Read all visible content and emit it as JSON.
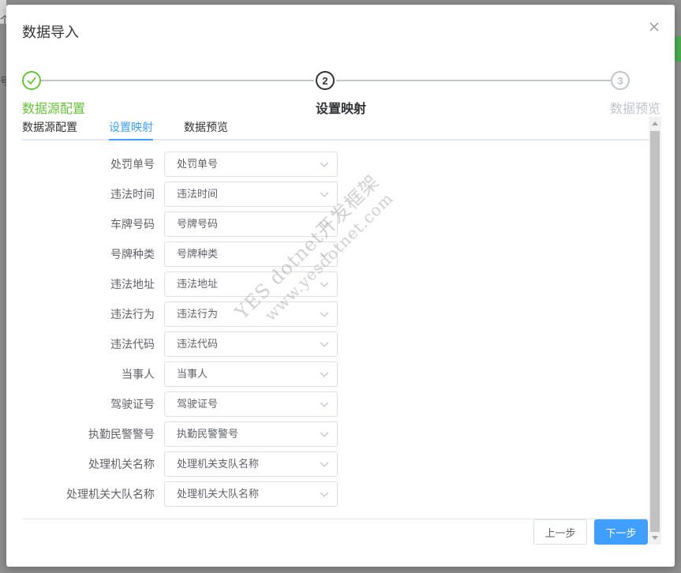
{
  "modal": {
    "title": "数据导入"
  },
  "background": {
    "edge_text_1": "个",
    "edge_text_2": "号"
  },
  "steps": [
    {
      "number": "1",
      "label": "数据源配置",
      "status": "done"
    },
    {
      "number": "2",
      "label": "设置映射",
      "status": "active"
    },
    {
      "number": "3",
      "label": "数据预览",
      "status": "wait"
    }
  ],
  "tabs": [
    {
      "label": "数据源配置",
      "active": false
    },
    {
      "label": "设置映射",
      "active": true
    },
    {
      "label": "数据预览",
      "active": false
    }
  ],
  "mappings": [
    {
      "label": "处罚单号",
      "value": "处罚单号"
    },
    {
      "label": "违法时间",
      "value": "违法时间"
    },
    {
      "label": "车牌号码",
      "value": "号牌号码"
    },
    {
      "label": "号牌种类",
      "value": "号牌种类"
    },
    {
      "label": "违法地址",
      "value": "违法地址"
    },
    {
      "label": "违法行为",
      "value": "违法行为"
    },
    {
      "label": "违法代码",
      "value": "违法代码"
    },
    {
      "label": "当事人",
      "value": "当事人"
    },
    {
      "label": "驾驶证号",
      "value": "驾驶证号"
    },
    {
      "label": "执勤民警警号",
      "value": "执勤民警警号"
    },
    {
      "label": "处理机关名称",
      "value": "处理机关支队名称"
    },
    {
      "label": "处理机关大队名称",
      "value": "处理机关大队名称"
    }
  ],
  "buttons": {
    "prev": "上一步",
    "next": "下一步"
  },
  "watermark": {
    "line1": "YES dotnet开发框架",
    "line2": "www.yesdotnet.com"
  },
  "colors": {
    "primary": "#409eff",
    "success": "#67c23a",
    "inactive": "#c0c4cc"
  }
}
